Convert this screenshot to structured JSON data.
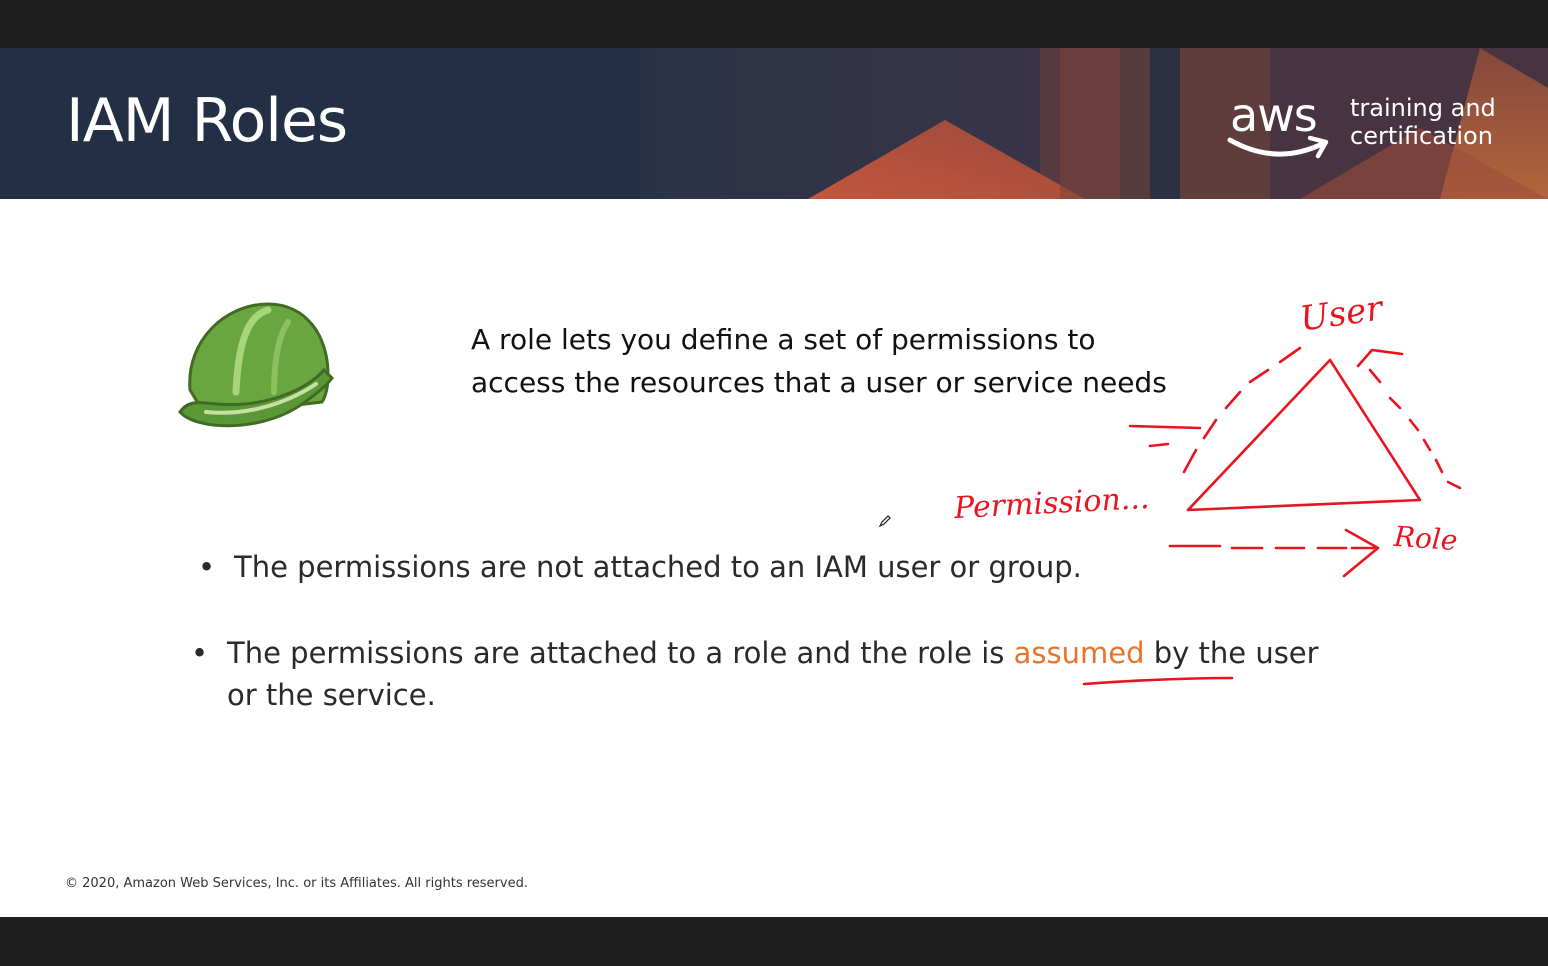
{
  "slide": {
    "title": "IAM Roles",
    "logo": {
      "wordmark": "aws",
      "tagline_line1": "training and",
      "tagline_line2": "certification"
    },
    "intro_line1": "A role lets you define a set of permissions to",
    "intro_line2": "access the resources that a user or service needs",
    "bullets": [
      {
        "marker": "•",
        "text": "The permissions are not attached to an IAM user or group."
      },
      {
        "marker": "•",
        "before": "The permissions are attached to a role and the role is ",
        "highlight": "assumed",
        "after": " by the user",
        "line2": "or the service."
      }
    ],
    "footer": "© 2020, Amazon Web Services, Inc. or its Affiliates. All rights reserved.",
    "icons": {
      "helmet": "hard-hat-icon",
      "cursor": "pen-cursor-icon"
    }
  },
  "annotations": {
    "user": "User",
    "permissions": "Permission...",
    "role": "Role"
  },
  "colors": {
    "header_bg": "#222f44",
    "highlight": "#e8742a",
    "ink": "#e8141e",
    "helmet": "#5e9a3a"
  }
}
